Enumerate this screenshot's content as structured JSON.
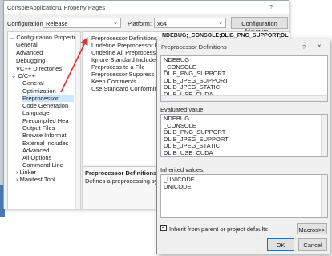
{
  "window": {
    "title": "ConsoleApplication1 Property Pages",
    "help": "?"
  },
  "config": {
    "label": "Configuration:",
    "value": "Release",
    "platform_label": "Platform:",
    "platform_value": "x64",
    "manager_button": "Configuration Manager..."
  },
  "tree": [
    "Configuration Properties",
    "General",
    "Advanced",
    "Debugging",
    "VC++ Directories",
    "C/C++",
    "General",
    "Optimization",
    "Preprocessor",
    "Code Generation",
    "Language",
    "Precompiled Hea",
    "Output Files",
    "Browse Informati",
    "External Includes",
    "Advanced",
    "All Options",
    "Command Line",
    "Linker",
    "Manifest Tool"
  ],
  "properties": [
    "Preprocessor Definitions",
    "Undefine Preprocessor Definitio",
    "Undefine All Preprocessor Defin",
    "Ignore Standard Include Paths",
    "Preprocess to a File",
    "Preprocessor Suppress Line Num",
    "Keep Comments",
    "Use Standard Conforming Prep"
  ],
  "selected_value": "NDEBUG;_CONSOLE;DLIB_PNG_SUPPORT;DLIB_JPEG_S",
  "description": {
    "title": "Preprocessor Definitions",
    "text": "Defines a preprocessing symbols f"
  },
  "dialog": {
    "title": "Preprocessor Definitions",
    "help": "?",
    "close": "×",
    "edit_lines": [
      "NDEBUG",
      "_CONSOLE",
      "DLIB_PNG_SUPPORT",
      "DLIB_JPEG_SUPPORT",
      "DLIB_JPEG_STATIC",
      "DLIB_USE_CUDA"
    ],
    "evaluated_label": "Evaluated value:",
    "evaluated_lines": [
      "NDEBUG",
      "_CONSOLE",
      "DLIB_PNG_SUPPORT",
      "DLIB_JPEG_SUPPORT",
      "DLIB_JPEG_STATIC",
      "DLIB_USE_CUDA"
    ],
    "inherited_label": "Inherited values:",
    "inherited_lines": [
      "_UNICODE",
      "UNICODE"
    ],
    "inherit_checkbox": "Inherit from parent or project defaults",
    "inherit_checked": true,
    "macros_button": "Macros>>",
    "ok_button": "OK",
    "cancel_button": "Cancel"
  },
  "colors": {
    "selection": "#cce8ff",
    "arrow": "#e03030",
    "accent_strip": "#4a78b5"
  }
}
